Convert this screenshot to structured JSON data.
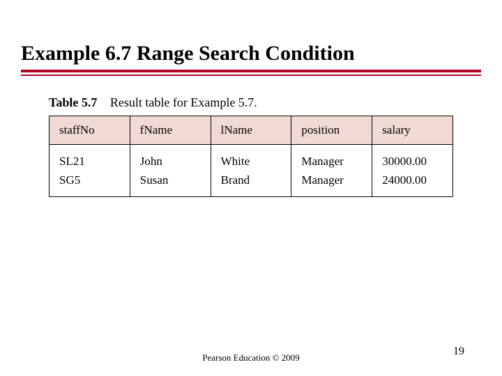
{
  "slide": {
    "title": "Example 6.7  Range Search Condition",
    "table_caption_label": "Table 5.7",
    "table_caption_text": "Result table for Example 5.7.",
    "headers": [
      "staffNo",
      "fName",
      "lName",
      "position",
      "salary"
    ],
    "rows": [
      {
        "staffNo": "SL21",
        "fName": "John",
        "lName": "White",
        "position": "Manager",
        "salary": "30000.00"
      },
      {
        "staffNo": "SG5",
        "fName": "Susan",
        "lName": "Brand",
        "position": "Manager",
        "salary": "24000.00"
      }
    ],
    "footer": "Pearson Education © 2009",
    "page_number": "19"
  },
  "chart_data": {
    "type": "table",
    "title": "Table 5.7  Result table for Example 5.7.",
    "columns": [
      "staffNo",
      "fName",
      "lName",
      "position",
      "salary"
    ],
    "rows": [
      [
        "SL21",
        "John",
        "White",
        "Manager",
        30000.0
      ],
      [
        "SG5",
        "Susan",
        "Brand",
        "Manager",
        24000.0
      ]
    ]
  }
}
